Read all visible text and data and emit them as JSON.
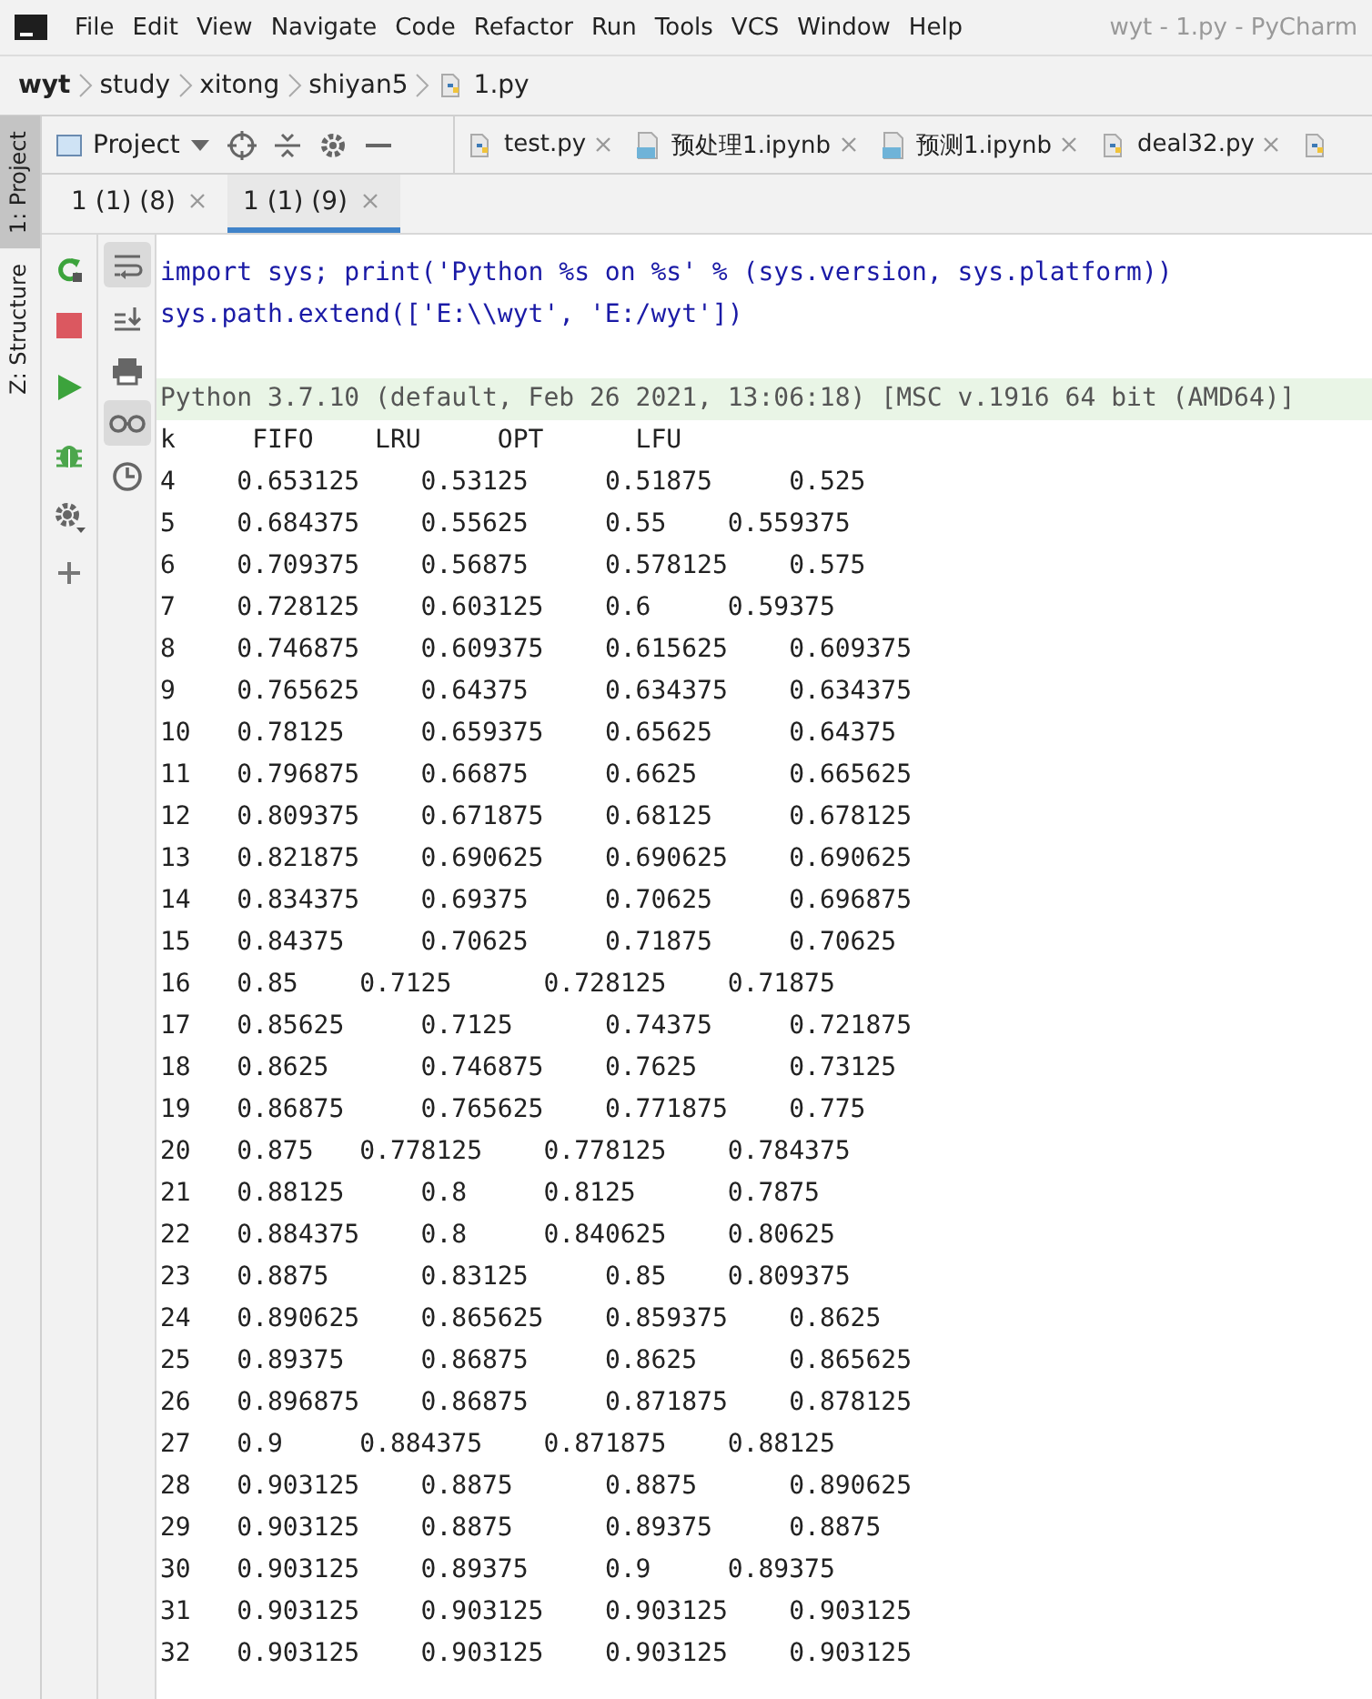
{
  "menu": [
    "File",
    "Edit",
    "View",
    "Navigate",
    "Code",
    "Refactor",
    "Run",
    "Tools",
    "VCS",
    "Window",
    "Help"
  ],
  "window": {
    "title": "wyt - 1.py - PyCharm"
  },
  "breadcrumbs": [
    {
      "label": "wyt",
      "kind": "project"
    },
    {
      "label": "study",
      "kind": "folder"
    },
    {
      "label": "xitong",
      "kind": "folder"
    },
    {
      "label": "shiyan5",
      "kind": "folder"
    },
    {
      "label": "1.py",
      "kind": "file"
    }
  ],
  "side_stripe": [
    {
      "label": "1: Project",
      "selected": true
    },
    {
      "label": "Z: Structure",
      "selected": false
    }
  ],
  "tool_window": {
    "title": "Project"
  },
  "editor_tabs": [
    {
      "label": "test.py",
      "kind": "py"
    },
    {
      "label": "预处理1.ipynb",
      "kind": "ipynb"
    },
    {
      "label": "预测1.ipynb",
      "kind": "ipynb"
    },
    {
      "label": "deal32.py",
      "kind": "py"
    }
  ],
  "console_tabs": [
    {
      "label": "1 (1) (8)",
      "selected": false
    },
    {
      "label": "1 (1) (9)",
      "selected": true
    }
  ],
  "run_toolbar": [
    {
      "kind": "rerun"
    },
    {
      "kind": "stop"
    },
    {
      "kind": "run"
    },
    {
      "kind": "debug"
    },
    {
      "kind": "settings"
    },
    {
      "kind": "add"
    }
  ],
  "console_toolbar": [
    {
      "kind": "wrap",
      "selected": true
    },
    {
      "kind": "scroll",
      "selected": false
    },
    {
      "kind": "print",
      "selected": false
    },
    {
      "kind": "glasses",
      "selected": true
    },
    {
      "kind": "history",
      "selected": false
    }
  ],
  "console": {
    "input": [
      "import sys; print('Python %s on %s' % (sys.version, sys.platform))",
      "sys.path.extend(['E:\\\\wyt', 'E:/wyt'])"
    ],
    "banner": "Python 3.7.10 (default, Feb 26 2021, 13:06:18) [MSC v.1916 64 bit (AMD64)]",
    "output": [
      "k \t  FIFO \t  LRU \t  OPT \t   LFU",
      "4 \t 0.653125 \t 0.53125 \t 0.51875 \t 0.525",
      "5 \t 0.684375 \t 0.55625 \t 0.55 \t 0.559375",
      "6 \t 0.709375 \t 0.56875 \t 0.578125 \t 0.575",
      "7 \t 0.728125 \t 0.603125 \t 0.6 \t 0.59375",
      "8 \t 0.746875 \t 0.609375 \t 0.615625 \t 0.609375",
      "9 \t 0.765625 \t 0.64375 \t 0.634375 \t 0.634375",
      "10 \t 0.78125 \t 0.659375 \t 0.65625 \t 0.64375",
      "11 \t 0.796875 \t 0.66875 \t 0.6625 \t 0.665625",
      "12 \t 0.809375 \t 0.671875 \t 0.68125 \t 0.678125",
      "13 \t 0.821875 \t 0.690625 \t 0.690625 \t 0.690625",
      "14 \t 0.834375 \t 0.69375 \t 0.70625 \t 0.696875",
      "15 \t 0.84375 \t 0.70625 \t 0.71875 \t 0.70625",
      "16 \t 0.85 \t 0.7125 \t 0.728125 \t 0.71875",
      "17 \t 0.85625 \t 0.7125 \t 0.74375 \t 0.721875",
      "18 \t 0.8625 \t 0.746875 \t 0.7625 \t 0.73125",
      "19 \t 0.86875 \t 0.765625 \t 0.771875 \t 0.775",
      "20 \t 0.875 \t 0.778125 \t 0.778125 \t 0.784375",
      "21 \t 0.88125 \t 0.8 \t 0.8125 \t 0.7875",
      "22 \t 0.884375 \t 0.8 \t 0.840625 \t 0.80625",
      "23 \t 0.8875 \t 0.83125 \t 0.85 \t 0.809375",
      "24 \t 0.890625 \t 0.865625 \t 0.859375 \t 0.8625",
      "25 \t 0.89375 \t 0.86875 \t 0.8625 \t 0.865625",
      "26 \t 0.896875 \t 0.86875 \t 0.871875 \t 0.878125",
      "27 \t 0.9 \t 0.884375 \t 0.871875 \t 0.88125",
      "28 \t 0.903125 \t 0.8875 \t 0.8875 \t 0.890625",
      "29 \t 0.903125 \t 0.8875 \t 0.89375 \t 0.8875",
      "30 \t 0.903125 \t 0.89375 \t 0.9 \t 0.89375",
      "31 \t 0.903125 \t 0.903125 \t 0.903125 \t 0.903125",
      "32 \t 0.903125 \t 0.903125 \t 0.903125 \t 0.903125"
    ]
  }
}
